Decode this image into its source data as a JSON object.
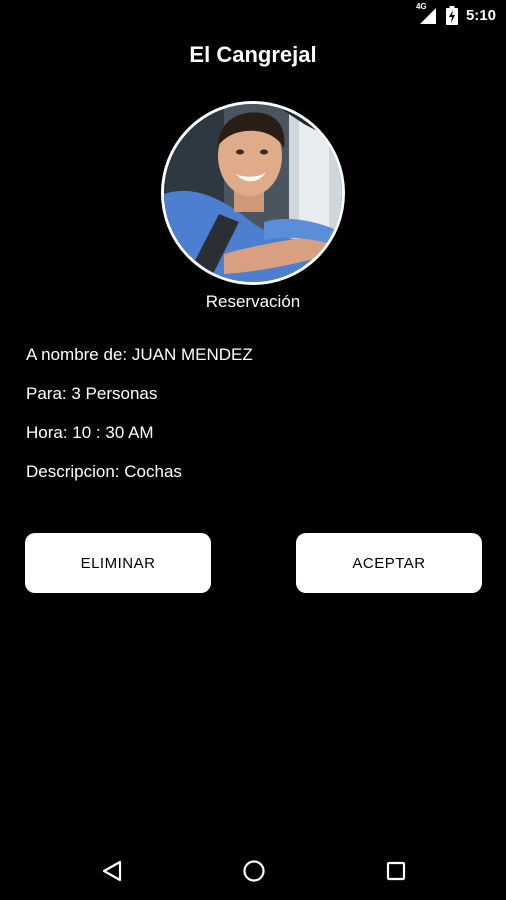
{
  "status_bar": {
    "network": "4G",
    "time": "5:10",
    "icons": [
      "signal-icon",
      "battery-charging-icon"
    ]
  },
  "header": {
    "title": "El Cangrejal"
  },
  "profile": {
    "caption": "Reservación"
  },
  "reservation": {
    "name_line": "A nombre de: JUAN MENDEZ",
    "party_line": "Para: 3 Personas",
    "time_line": "Hora: 10 : 30 AM",
    "description_line": "Descripcion: Cochas"
  },
  "actions": {
    "delete_label": "ELIMINAR",
    "accept_label": "ACEPTAR"
  },
  "nav_bar": {
    "icons": [
      "back-icon",
      "home-icon",
      "recents-icon"
    ]
  },
  "colors": {
    "background": "#000000",
    "text": "#ffffff",
    "button_bg": "#ffffff",
    "button_text": "#000000"
  }
}
